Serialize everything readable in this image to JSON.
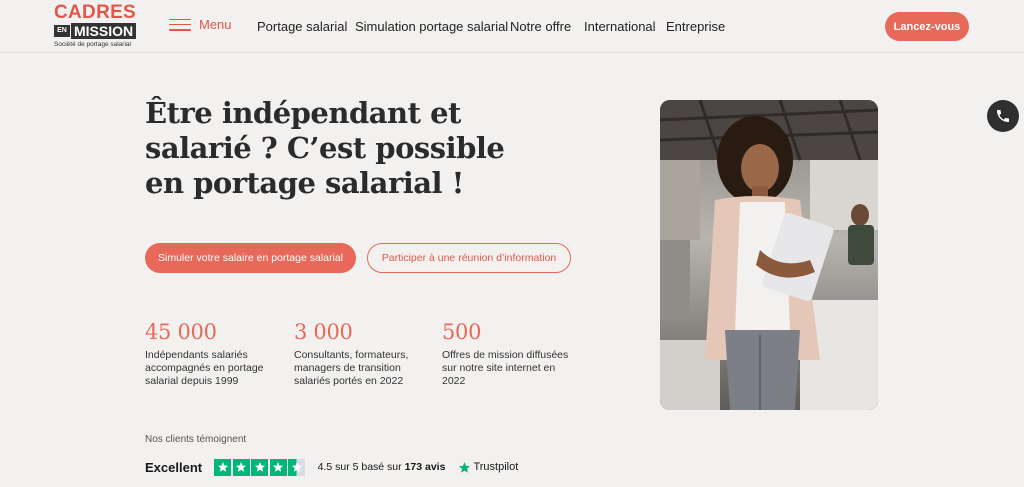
{
  "header": {
    "logo": {
      "line1": "CADRES",
      "en": "EN",
      "mission": "MISSION",
      "tagline": "Société de portage salarial"
    },
    "menu_label": "Menu",
    "nav": [
      "Portage salarial",
      "Simulation portage salarial",
      "Notre offre",
      "International",
      "Entreprise"
    ],
    "cta_label": "Lancez-vous"
  },
  "hero": {
    "title_line1": "Être indépendant et",
    "title_line2": "salarié ? C’est possible",
    "title_line3": "en portage salarial !",
    "primary_button": "Simuler votre salaire en portage salarial",
    "secondary_button": "Participer à une réunion d’information"
  },
  "stats": [
    {
      "value": "45 000",
      "desc_line1": "Indépendants salariés",
      "desc_line2": "accompagnés en portage",
      "desc_line3": "salarial depuis 1999"
    },
    {
      "value": "3 000",
      "desc_line1": "Consultants, formateurs,",
      "desc_line2": "managers de transition",
      "desc_line3": "salariés portés en 2022"
    },
    {
      "value": "500",
      "desc_line1": "Offres de mission diffusées",
      "desc_line2": "sur notre site internet en",
      "desc_line3": "2022"
    }
  ],
  "testimonials": {
    "label": "Nos clients témoignent",
    "rating_word": "Excellent",
    "rating_stars": 4.5,
    "score_prefix": "4.5 sur 5 basé sur",
    "review_count": "173 avis",
    "brand": "Trustpilot"
  },
  "colors": {
    "accent": "#e8685a",
    "background": "#f3f1ef",
    "trustpilot": "#00b67a"
  },
  "icons": {
    "menu": "hamburger-icon",
    "phone": "phone-icon",
    "star": "star-icon"
  }
}
